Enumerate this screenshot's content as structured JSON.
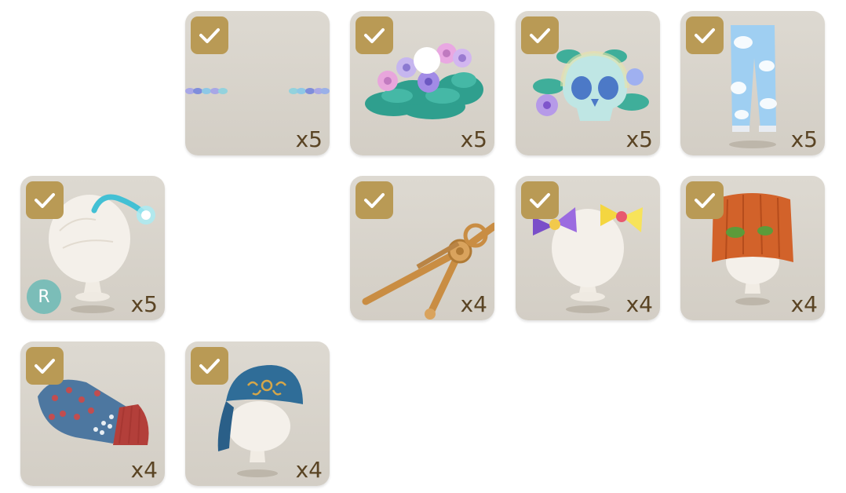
{
  "items": [
    {
      "name": "flower-ears-accessory",
      "quantity": "x5",
      "checked": true
    },
    {
      "name": "flower-bush-decor",
      "quantity": "x5",
      "checked": true
    },
    {
      "name": "flower-skull-decor",
      "quantity": "x5",
      "checked": true
    },
    {
      "name": "cloud-pattern-pants",
      "quantity": "x5",
      "checked": true
    },
    {
      "name": "glowing-antenna-headpiece",
      "quantity": "x5",
      "checked": true,
      "rarity": "R"
    },
    {
      "name": "wooden-compass-tool",
      "quantity": "x4",
      "checked": true
    },
    {
      "name": "double-bow-hair-clips",
      "quantity": "x4",
      "checked": true
    },
    {
      "name": "orange-knit-beanie",
      "quantity": "x4",
      "checked": true
    },
    {
      "name": "blue-knit-mitten",
      "quantity": "x4",
      "checked": true
    },
    {
      "name": "blue-bandana-hat",
      "quantity": "x4",
      "checked": true
    }
  ],
  "icons": {
    "checkmark": "check-icon",
    "rarity": "rarity-badge"
  },
  "colors": {
    "tile_bg": "#d8d4cc",
    "check_bg": "#b99a55",
    "qty_text": "#5a4424",
    "rarity_bg": "#7bbdb8"
  }
}
